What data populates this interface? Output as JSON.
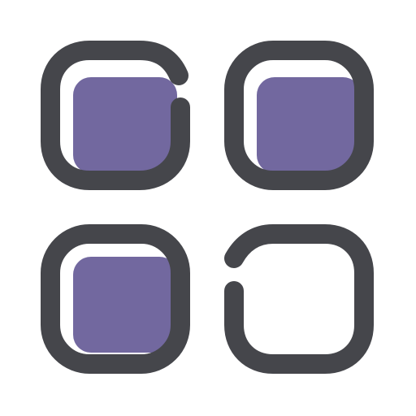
{
  "icon": {
    "name": "app-grid-icon",
    "stroke_color": "#45464b",
    "fill_color": "#72689f",
    "background_color": "#ffffff",
    "tiles": [
      {
        "name": "grid-tile-top-left",
        "filled": true,
        "style": "open-corner"
      },
      {
        "name": "grid-tile-top-right",
        "filled": true,
        "style": "closed"
      },
      {
        "name": "grid-tile-bottom-left",
        "filled": true,
        "style": "closed"
      },
      {
        "name": "grid-tile-bottom-right",
        "filled": false,
        "style": "open-corner"
      }
    ]
  }
}
